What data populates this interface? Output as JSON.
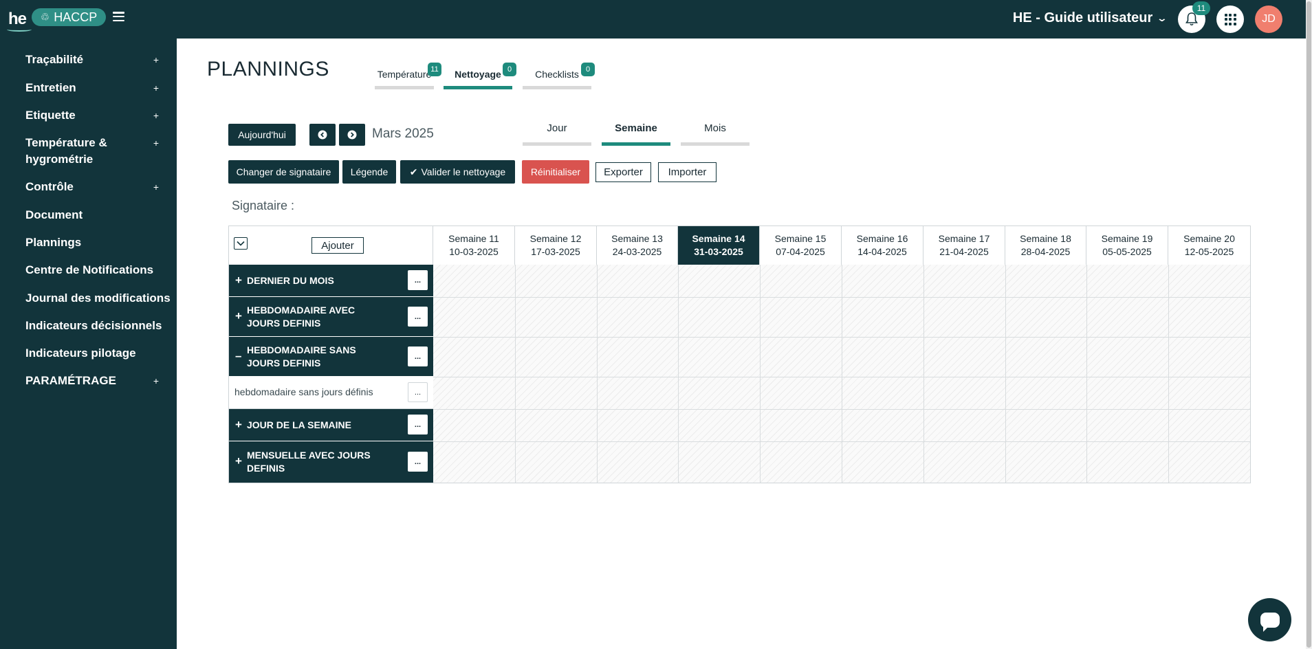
{
  "topbar": {
    "logo": "he",
    "app_name": "HACCP",
    "site": "HE - Guide utilisateur",
    "notifications_count": "11",
    "avatar_initials": "JD"
  },
  "sidebar": {
    "items": [
      {
        "label": "Traçabilité",
        "expand": "+"
      },
      {
        "label": "Entretien",
        "expand": "+"
      },
      {
        "label": "Etiquette",
        "expand": "+"
      },
      {
        "label": "Température & hygrométrie",
        "expand": "+"
      },
      {
        "label": "Contrôle",
        "expand": "+"
      },
      {
        "label": "Document"
      },
      {
        "label": "Plannings"
      },
      {
        "label": "Centre de Notifications"
      },
      {
        "label": "Journal des modifications"
      },
      {
        "label": "Indicateurs décisionnels"
      },
      {
        "label": "Indicateurs pilotage"
      },
      {
        "label": "PARAMÉTRAGE",
        "expand": "+"
      }
    ]
  },
  "page": {
    "title": "PLANNINGS",
    "tabs": [
      {
        "label": "Température",
        "badge": "11"
      },
      {
        "label": "Nettoyage",
        "badge": "0",
        "active": true
      },
      {
        "label": "Checklists",
        "badge": "0"
      }
    ]
  },
  "toolbar": {
    "today": "Aujourd'hui",
    "prev_icon": "chevron-left-icon",
    "next_icon": "chevron-right-icon",
    "month": "Mars 2025",
    "views": [
      {
        "label": "Jour"
      },
      {
        "label": "Semaine",
        "active": true
      },
      {
        "label": "Mois"
      }
    ],
    "change_signataire": "Changer de signataire",
    "legende": "Légende",
    "valider": "Valider le nettoyage",
    "reinitialiser": "Réinitialiser",
    "exporter": "Exporter",
    "importer": "Importer",
    "signataire_label": "Signataire :"
  },
  "grid": {
    "add_label": "Ajouter",
    "weeks": [
      {
        "label": "Semaine 11",
        "date": "10-03-2025"
      },
      {
        "label": "Semaine 12",
        "date": "17-03-2025"
      },
      {
        "label": "Semaine 13",
        "date": "24-03-2025"
      },
      {
        "label": "Semaine 14",
        "date": "31-03-2025",
        "current": true
      },
      {
        "label": "Semaine 15",
        "date": "07-04-2025"
      },
      {
        "label": "Semaine 16",
        "date": "14-04-2025"
      },
      {
        "label": "Semaine 17",
        "date": "21-04-2025"
      },
      {
        "label": "Semaine 18",
        "date": "28-04-2025"
      },
      {
        "label": "Semaine 19",
        "date": "05-05-2025"
      },
      {
        "label": "Semaine 20",
        "date": "12-05-2025"
      }
    ],
    "rows": [
      {
        "label": "DERNIER DU MOIS",
        "toggle": "+",
        "more": "..."
      },
      {
        "label": "HEBDOMADAIRE AVEC JOURS DEFINIS",
        "toggle": "+",
        "more": "..."
      },
      {
        "label": "HEBDOMADAIRE SANS JOURS DEFINIS",
        "toggle": "–",
        "more": "..."
      },
      {
        "label": "hebdomadaire sans jours définis",
        "sub": true,
        "more": "..."
      },
      {
        "label": "JOUR DE LA SEMAINE",
        "toggle": "+",
        "more": "..."
      },
      {
        "label": "MENSUELLE AVEC JOURS DEFINIS",
        "toggle": "+",
        "more": "..."
      }
    ]
  },
  "colors": {
    "primary_dark": "#12343b",
    "accent": "#1e8b7d",
    "danger": "#d9534f",
    "avatar": "#f07f6e"
  }
}
